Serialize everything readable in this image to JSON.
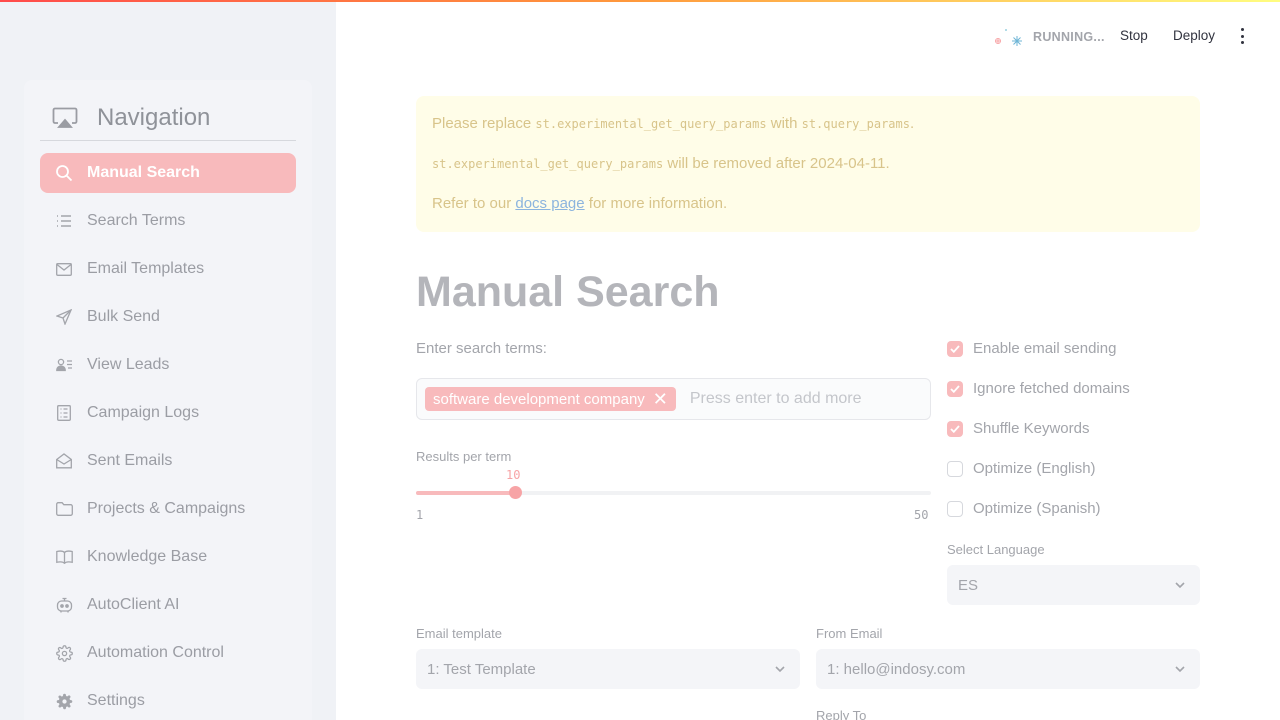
{
  "toolbar": {
    "status": "RUNNING...",
    "stop": "Stop",
    "deploy": "Deploy"
  },
  "sidebar": {
    "title": "Navigation",
    "items": [
      {
        "label": "Manual Search",
        "icon": "search-icon",
        "active": true
      },
      {
        "label": "Search Terms",
        "icon": "list-icon"
      },
      {
        "label": "Email Templates",
        "icon": "envelope-icon"
      },
      {
        "label": "Bulk Send",
        "icon": "send-icon"
      },
      {
        "label": "View Leads",
        "icon": "contacts-icon"
      },
      {
        "label": "Campaign Logs",
        "icon": "log-icon"
      },
      {
        "label": "Sent Emails",
        "icon": "open-envelope-icon"
      },
      {
        "label": "Projects & Campaigns",
        "icon": "folder-icon"
      },
      {
        "label": "Knowledge Base",
        "icon": "book-icon"
      },
      {
        "label": "AutoClient AI",
        "icon": "robot-icon"
      },
      {
        "label": "Automation Control",
        "icon": "gear-outline-icon"
      },
      {
        "label": "Settings",
        "icon": "gear-icon"
      }
    ]
  },
  "warning": {
    "prefix": "Please replace ",
    "old_api": "st.experimental_get_query_params",
    "with_word": " with ",
    "new_api": "st.query_params",
    "period": ".",
    "line2_api": "st.experimental_get_query_params",
    "line2_text": " will be removed after 2024-04-11.",
    "line3_prefix": "Refer to our ",
    "line3_link": "docs page",
    "line3_suffix": " for more information."
  },
  "main": {
    "title": "Manual Search",
    "search_label": "Enter search terms:",
    "tags": [
      "software development company"
    ],
    "tag_placeholder": "Press enter to add more",
    "slider": {
      "label": "Results per term",
      "value": 10,
      "min": 1,
      "max": 50
    },
    "checks": [
      {
        "label": "Enable email sending",
        "checked": true
      },
      {
        "label": "Ignore fetched domains",
        "checked": true
      },
      {
        "label": "Shuffle Keywords",
        "checked": true
      },
      {
        "label": "Optimize (English)",
        "checked": false
      },
      {
        "label": "Optimize (Spanish)",
        "checked": false
      }
    ],
    "language": {
      "label": "Select Language",
      "value": "ES"
    },
    "email_template": {
      "label": "Email template",
      "value": "1: Test Template"
    },
    "from_email": {
      "label": "From Email",
      "value": "1: hello@indosy.com"
    },
    "reply_to": {
      "label": "Reply To"
    }
  }
}
